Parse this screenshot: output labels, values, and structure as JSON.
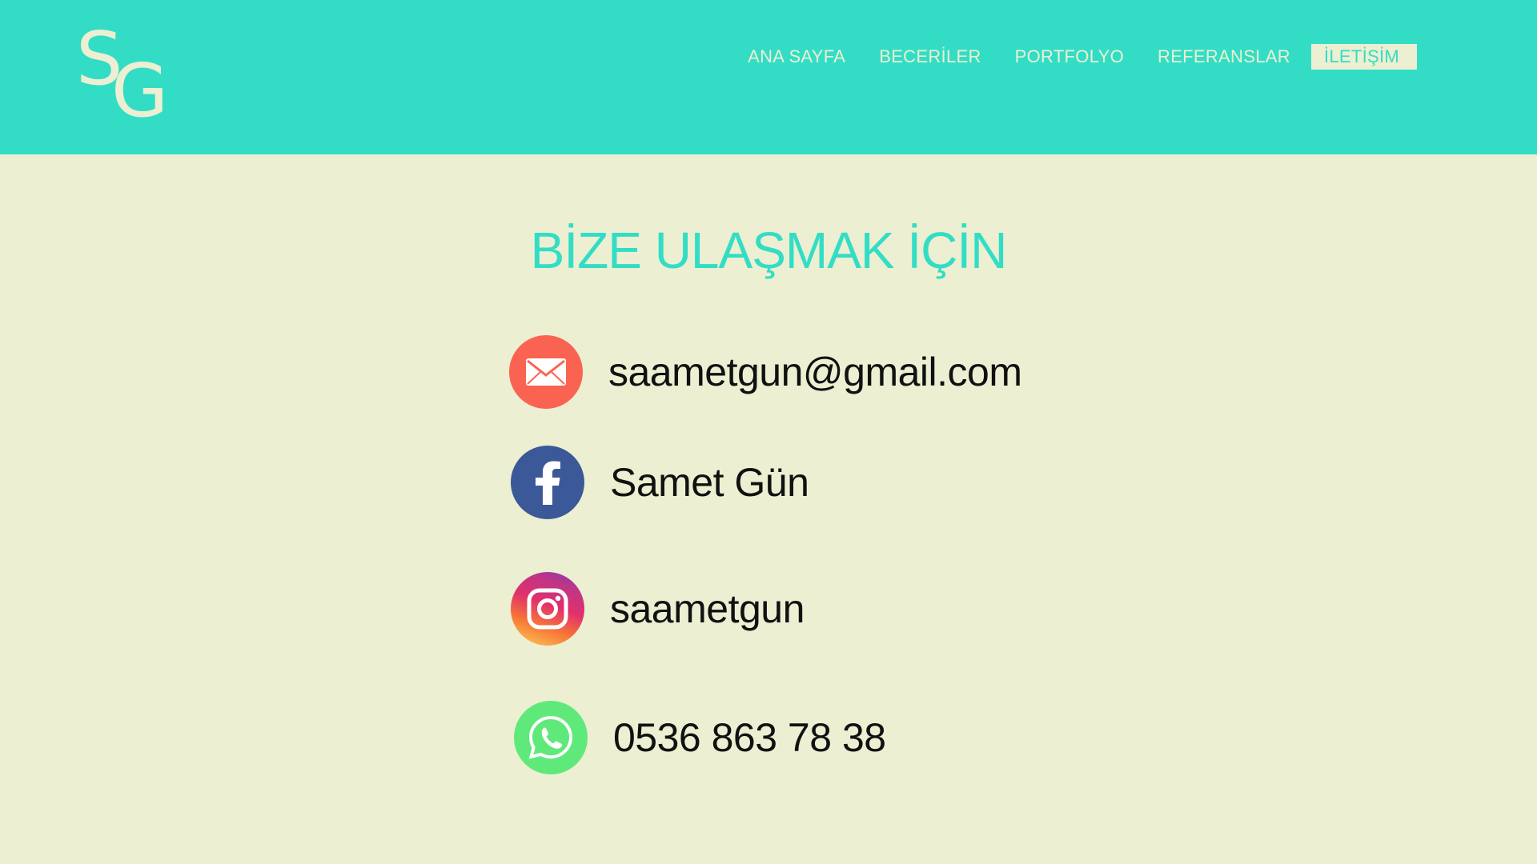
{
  "logo": {
    "s": "S",
    "g": "G"
  },
  "nav": {
    "items": [
      {
        "label": "ANA SAYFA"
      },
      {
        "label": "BECERİLER"
      },
      {
        "label": "PORTFOLYO"
      },
      {
        "label": "REFERANSLAR"
      },
      {
        "label": "İLETİŞİM",
        "active": true
      }
    ]
  },
  "main": {
    "title": "BİZE ULAŞMAK İÇİN"
  },
  "contacts": {
    "email": {
      "text": "saametgun@gmail.com",
      "icon": "mail-icon"
    },
    "facebook": {
      "text": "Samet Gün",
      "icon": "facebook-icon"
    },
    "instagram": {
      "text": "saametgun",
      "icon": "instagram-icon"
    },
    "phone": {
      "text": "0536 863 78 38",
      "icon": "whatsapp-icon"
    }
  },
  "colors": {
    "header": "#33ddc5",
    "background": "#ecefd1",
    "mail": "#fa6352",
    "facebook": "#3b5998",
    "whatsapp": "#5fe97a",
    "text": "#111111"
  }
}
